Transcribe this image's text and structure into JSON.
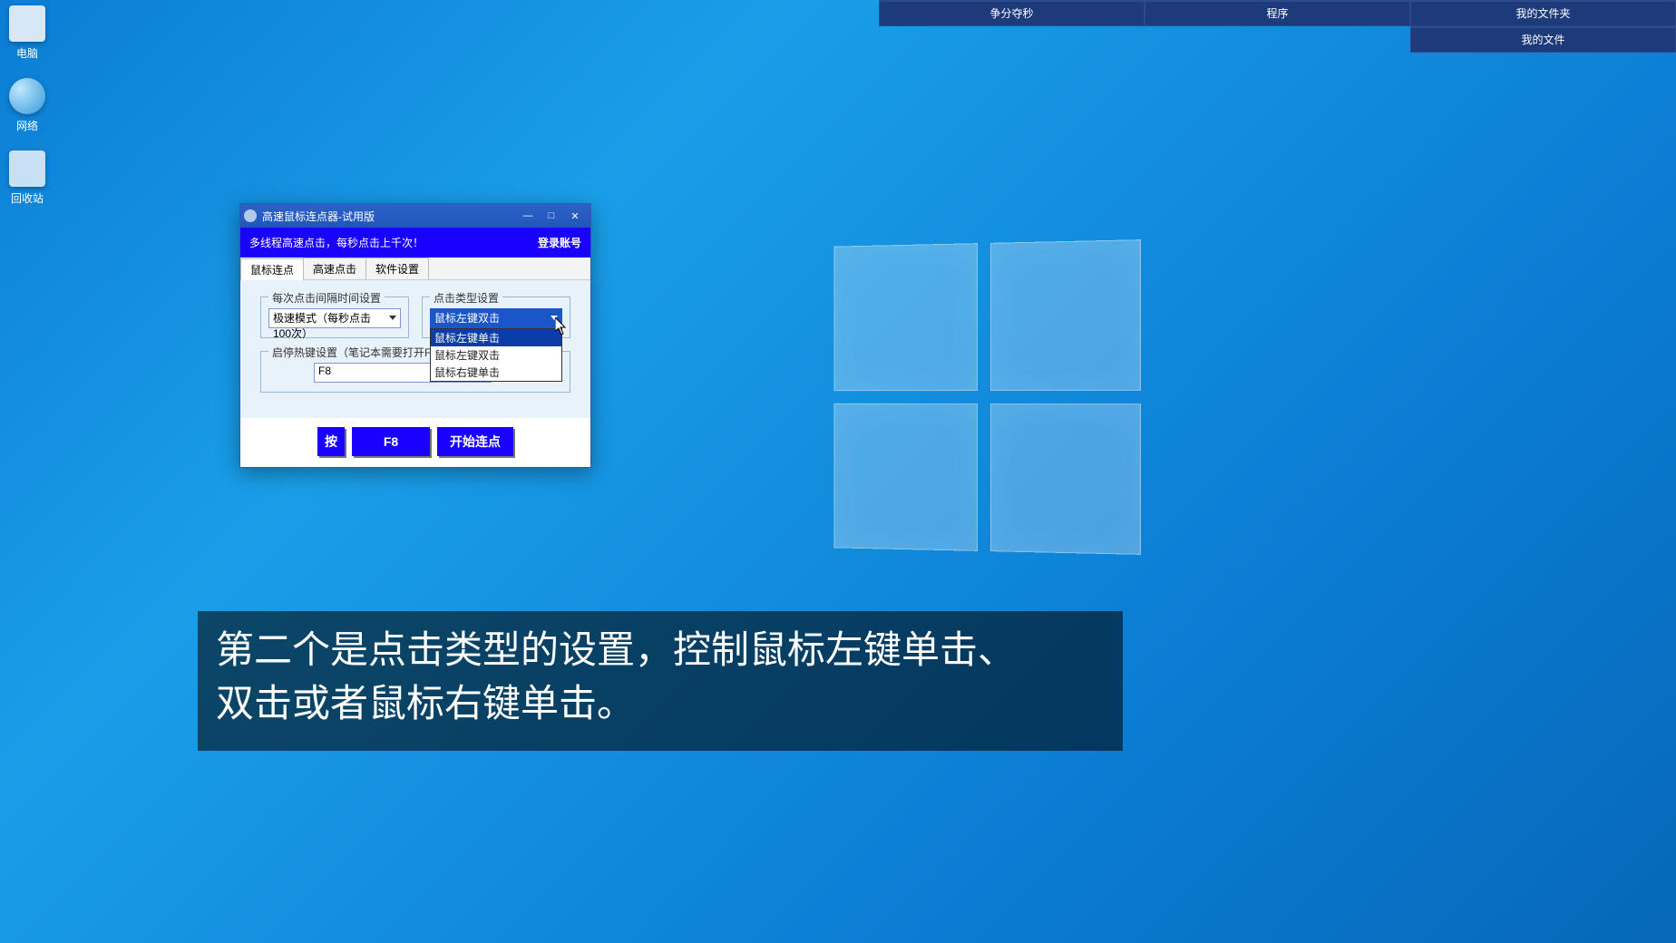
{
  "topmenus": {
    "row1": [
      "争分夺秒",
      "程序",
      "我的文件夹"
    ],
    "row2": [
      "我的文件"
    ]
  },
  "desktopIcons": {
    "pc": "电脑",
    "net": "网络",
    "rec": "回收站"
  },
  "app": {
    "title": "高速鼠标连点器-试用版",
    "banner_slogan": "多线程高速点击，每秒点击上千次！",
    "login_label": "登录账号",
    "tabs": [
      "鼠标连点",
      "高速点击",
      "软件设置"
    ],
    "groups": {
      "interval_legend": "每次点击间隔时间设置",
      "interval_value": "极速模式（每秒点击100次）",
      "clicktype_legend": "点击类型设置",
      "clicktype_selected": "鼠标左键双击",
      "clicktype_options": [
        "鼠标左键单击",
        "鼠标左键双击",
        "鼠标右键单击"
      ],
      "hotkey_legend": "启停热键设置（笔记本需要打开Fn键）",
      "hotkey_value": "F8"
    },
    "buttons": {
      "press": "按",
      "fkey": "F8",
      "start": "开始连点"
    },
    "winbtns": {
      "min": "—",
      "max": "□",
      "close": "✕"
    }
  },
  "subtitle": {
    "line1": "第二个是点击类型的设置，控制鼠标左键单击、",
    "line2": "双击或者鼠标右键单击。"
  }
}
